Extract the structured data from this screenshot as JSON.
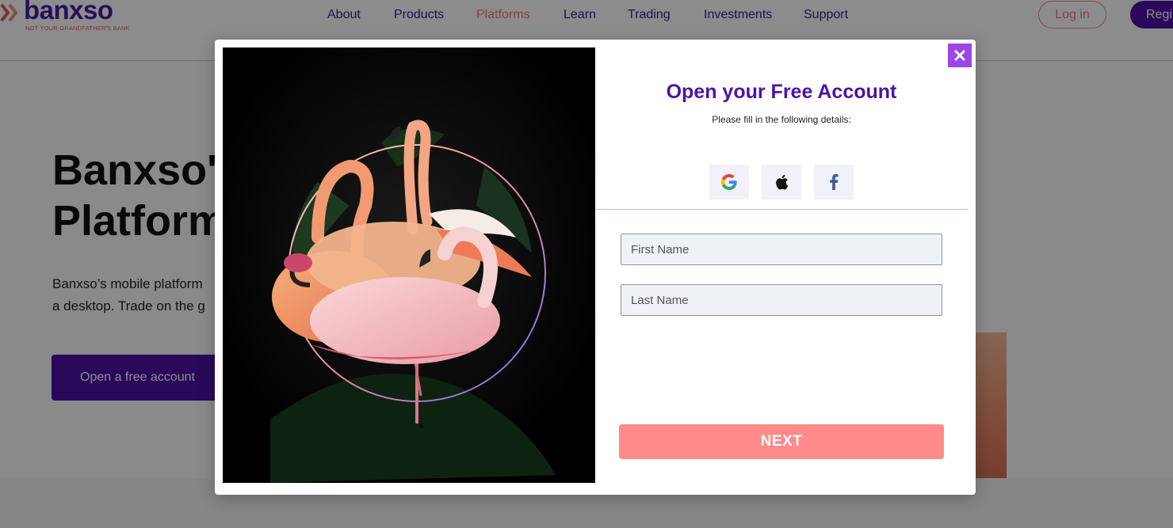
{
  "header": {
    "logo_text": "banxso",
    "logo_tagline": "NOT YOUR GRANDFATHER'S BANK",
    "nav": [
      {
        "label": "About"
      },
      {
        "label": "Products"
      },
      {
        "label": "Platforms"
      },
      {
        "label": "Learn"
      },
      {
        "label": "Trading"
      },
      {
        "label": "Investments"
      },
      {
        "label": "Support"
      }
    ],
    "active_nav": "Platforms",
    "login_label": "Log in",
    "register_label": "Regi"
  },
  "hero": {
    "title_line1": "Banxso's",
    "title_line2": "Platform",
    "text_line1": "Banxso’s mobile platform",
    "text_line2": "a desktop. Trade on the g",
    "cta_label": "Open a free account"
  },
  "modal": {
    "title": "Open your Free Account",
    "subtitle": "Please fill in the following details:",
    "close_icon": "close-icon",
    "social": [
      {
        "icon": "google-icon"
      },
      {
        "icon": "apple-icon"
      },
      {
        "icon": "facebook-icon"
      }
    ],
    "first_name_placeholder": "First Name",
    "last_name_placeholder": "Last Name",
    "next_label": "NEXT"
  },
  "colors": {
    "brand_purple": "#4d12a8",
    "accent_coral": "#ff8a8a",
    "close_purple": "#9b45e6"
  }
}
